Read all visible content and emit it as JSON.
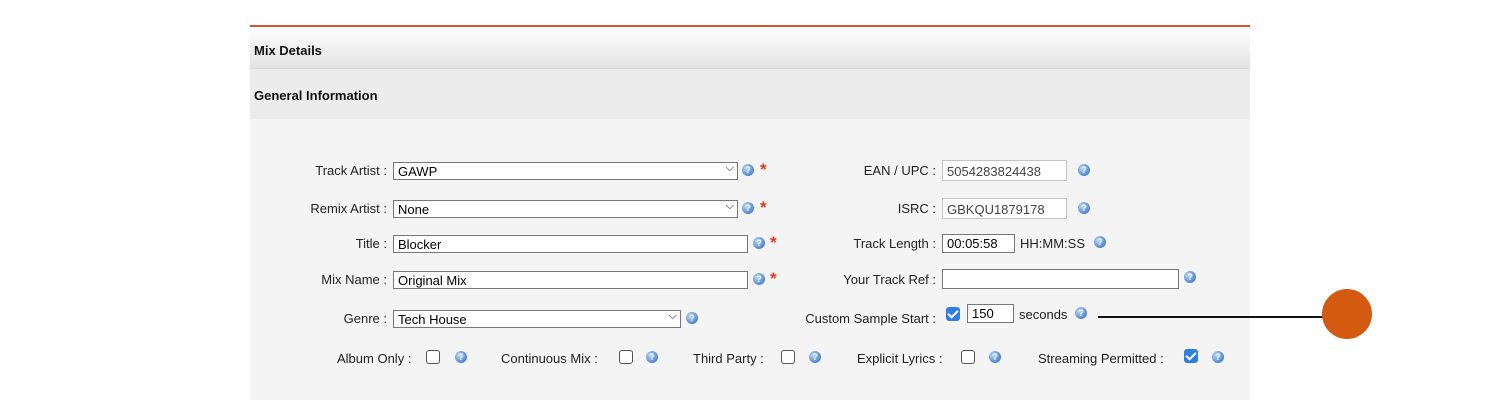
{
  "section_title": "Mix Details",
  "subsection_title": "General Information",
  "fields": {
    "track_artist": {
      "label": "Track Artist :",
      "value": "GAWP"
    },
    "remix_artist": {
      "label": "Remix Artist :",
      "value": "None"
    },
    "title": {
      "label": "Title :",
      "value": "Blocker"
    },
    "mix_name": {
      "label": "Mix Name :",
      "value": "Original Mix"
    },
    "genre": {
      "label": "Genre :",
      "value": "Tech House"
    },
    "ean_upc": {
      "label": "EAN / UPC :",
      "value": "5054283824438"
    },
    "isrc": {
      "label": "ISRC :",
      "value": "GBKQU1879178"
    },
    "track_length": {
      "label": "Track Length :",
      "value": "00:05:58",
      "unit": "HH:MM:SS"
    },
    "your_track_ref": {
      "label": "Your Track Ref :",
      "value": ""
    },
    "custom_sample_start": {
      "label": "Custom Sample Start :",
      "checked": true,
      "value": "150",
      "unit": "seconds"
    }
  },
  "flags": {
    "album_only": {
      "label": "Album Only :",
      "checked": false
    },
    "continuous_mix": {
      "label": "Continuous Mix :",
      "checked": false
    },
    "third_party": {
      "label": "Third Party :",
      "checked": false
    },
    "explicit_lyrics": {
      "label": "Explicit Lyrics :",
      "checked": false
    },
    "streaming_permitted": {
      "label": "Streaming Permitted :",
      "checked": true
    }
  },
  "icons": {
    "help": "help-icon",
    "dropdown": "chevron-down-icon",
    "required": "*"
  },
  "colors": {
    "accent_line": "#d6542f",
    "required": "#e0391f",
    "checkbox_checked": "#2f7de1",
    "callout": "#d45a12"
  }
}
